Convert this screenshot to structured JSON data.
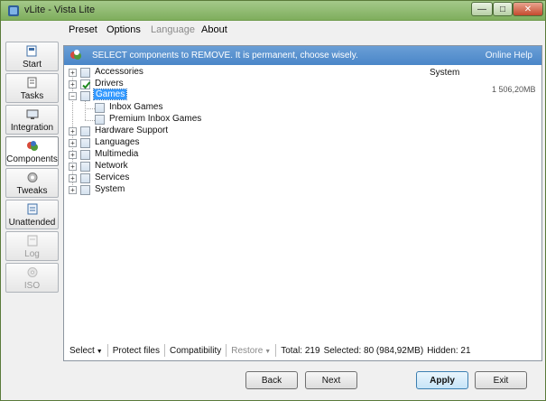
{
  "window": {
    "title": "vLite - Vista Lite"
  },
  "menu": [
    {
      "label": "Preset",
      "disabled": false
    },
    {
      "label": "Options",
      "disabled": false
    },
    {
      "label": "Language",
      "disabled": true
    },
    {
      "label": "About",
      "disabled": false
    }
  ],
  "sidebar": [
    {
      "label": "Start",
      "icon": "start-icon",
      "state": "normal"
    },
    {
      "label": "Tasks",
      "icon": "tasks-icon",
      "state": "normal"
    },
    {
      "label": "Integration",
      "icon": "integration-icon",
      "state": "normal"
    },
    {
      "label": "Components",
      "icon": "components-icon",
      "state": "active"
    },
    {
      "label": "Tweaks",
      "icon": "tweaks-icon",
      "state": "normal"
    },
    {
      "label": "Unattended",
      "icon": "unattended-icon",
      "state": "normal"
    },
    {
      "label": "Log",
      "icon": "log-icon",
      "state": "disabled"
    },
    {
      "label": "ISO",
      "icon": "iso-icon",
      "state": "disabled"
    }
  ],
  "banner": {
    "text": "SELECT components to REMOVE. It is permanent, choose wisely.",
    "link": "Online Help",
    "color": "#4a86c8"
  },
  "tree": [
    {
      "label": "Accessories",
      "checked": false,
      "selected": false
    },
    {
      "label": "Drivers",
      "checked": true,
      "selected": false
    },
    {
      "label": "Games",
      "checked": false,
      "selected": true
    },
    {
      "label": "Inbox Games",
      "checked": false,
      "selected": false
    },
    {
      "label": "Premium Inbox Games",
      "checked": false,
      "selected": false
    },
    {
      "label": "Hardware Support",
      "checked": false,
      "selected": false
    },
    {
      "label": "Languages",
      "checked": false,
      "selected": false
    },
    {
      "label": "Multimedia",
      "checked": false,
      "selected": false
    },
    {
      "label": "Network",
      "checked": false,
      "selected": false
    },
    {
      "label": "Services",
      "checked": false,
      "selected": false
    },
    {
      "label": "System",
      "checked": false,
      "selected": false
    }
  ],
  "details": {
    "category": "System",
    "size": "1 506,20MB"
  },
  "statusbar": {
    "select": "Select",
    "protect": "Protect files",
    "compat": "Compatibility",
    "restore": "Restore",
    "total": "Total: 219",
    "selected": "Selected: 80 (984,92MB)",
    "hidden": "Hidden: 21"
  },
  "buttons": {
    "back": "Back",
    "next": "Next",
    "apply": "Apply",
    "exit": "Exit"
  }
}
